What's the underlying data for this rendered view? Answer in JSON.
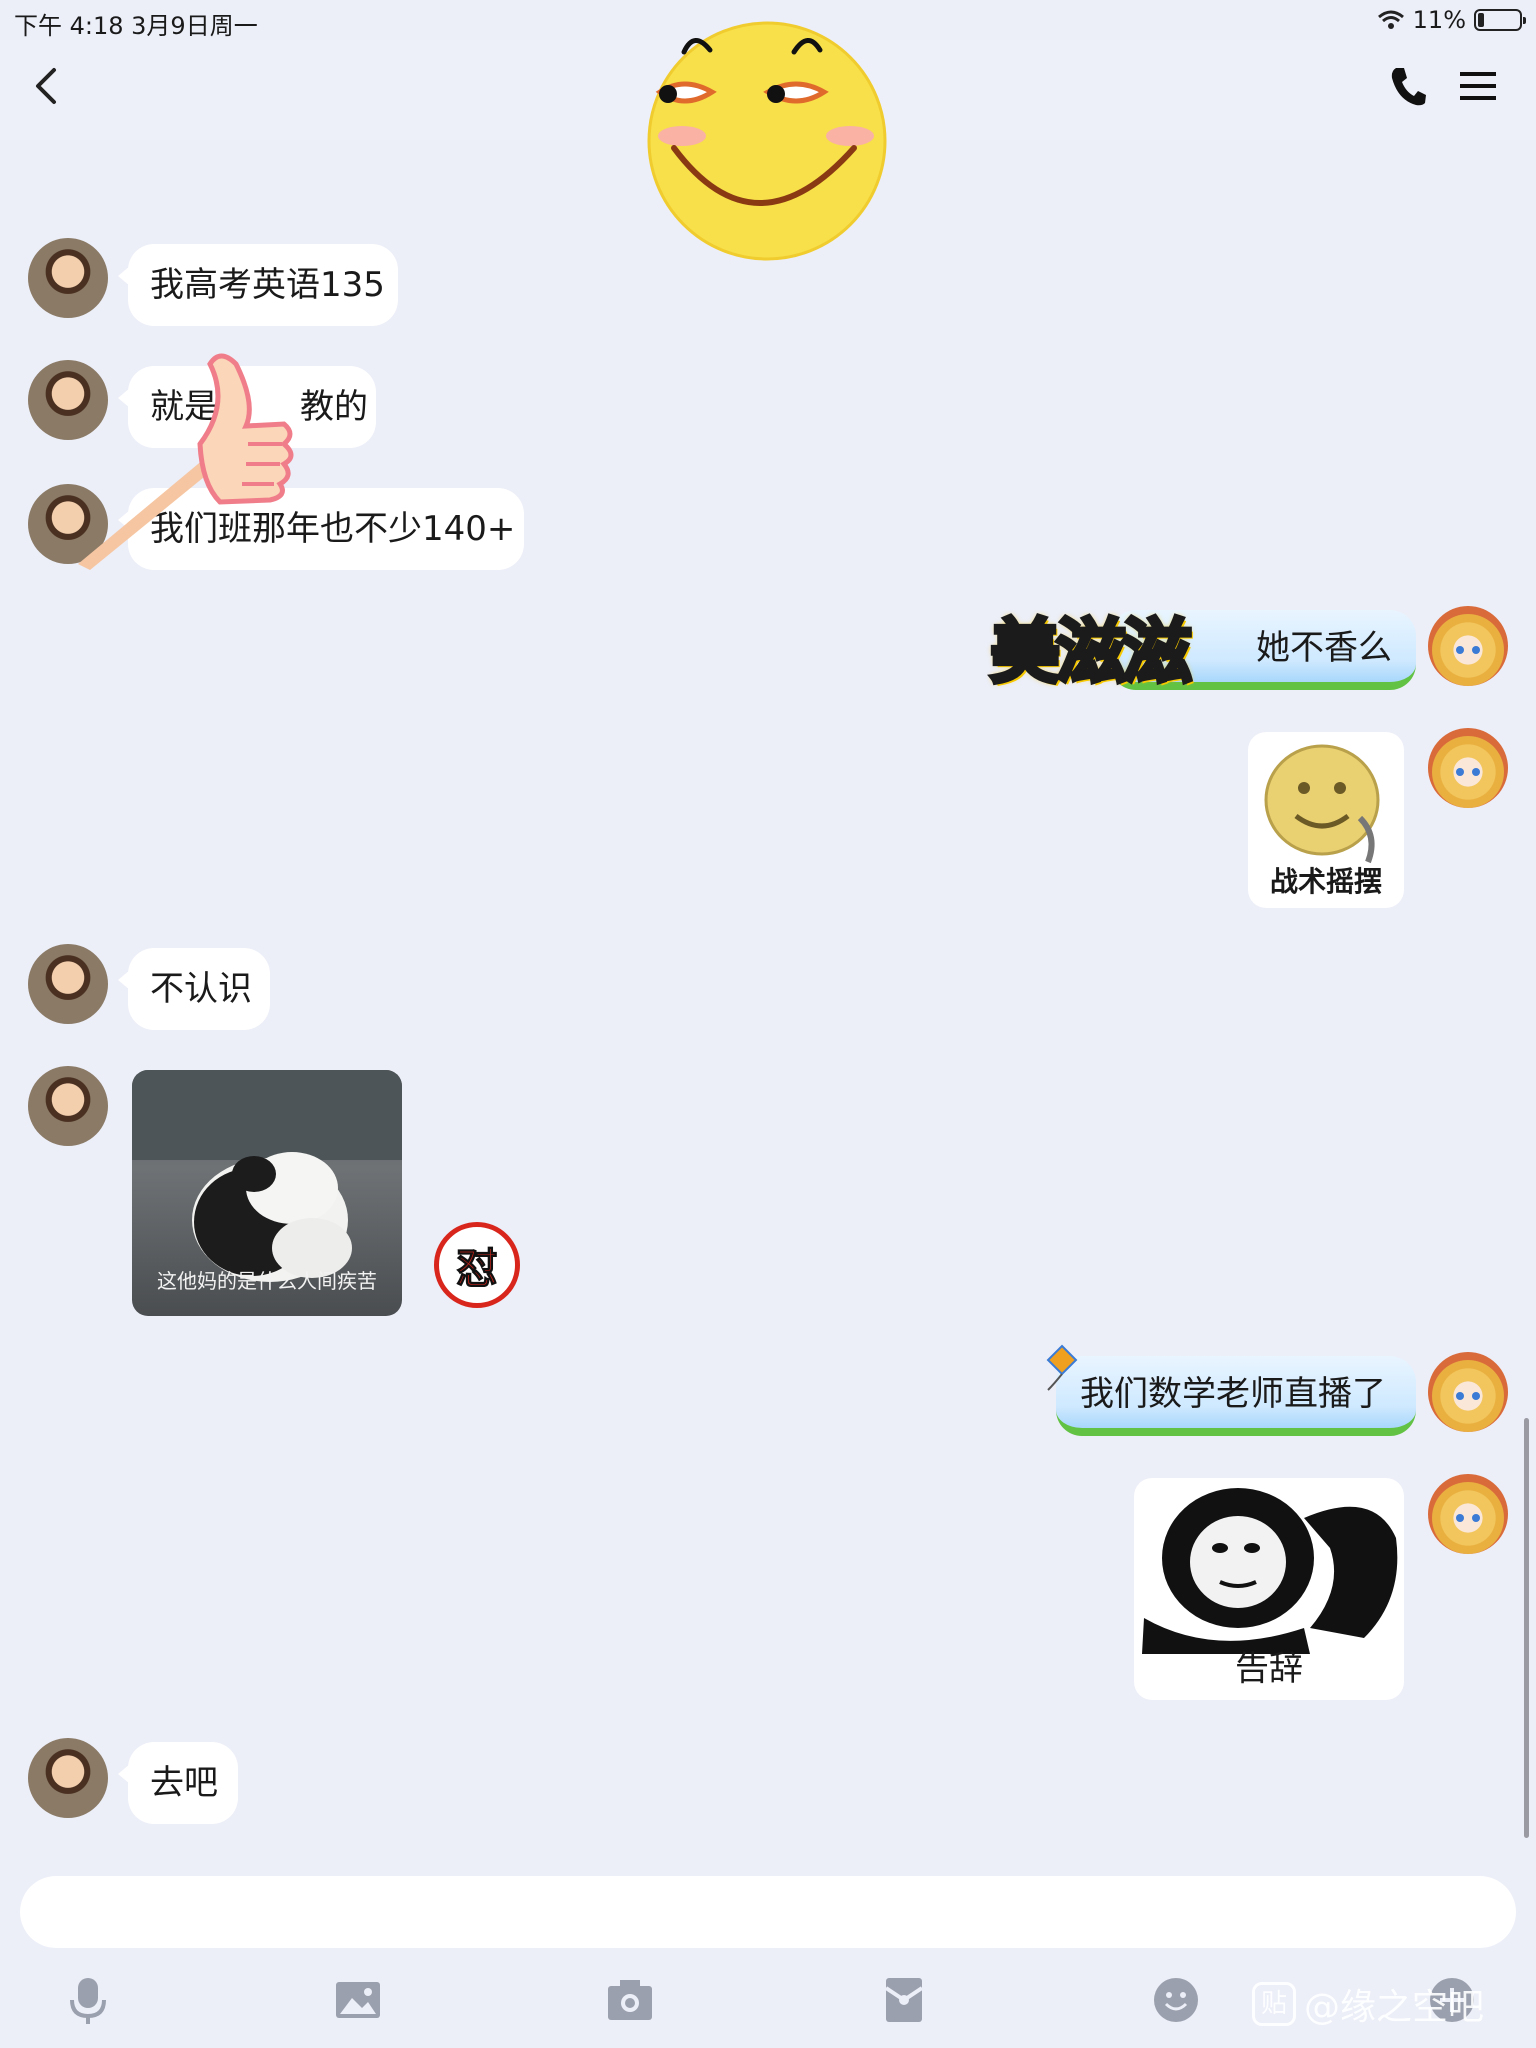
{
  "status_bar": {
    "time_date": "下午 4:18   3月9日周一",
    "battery": "11%"
  },
  "messages": {
    "m1": "我高考英语135",
    "m2a": "就是",
    "m2b": "教的",
    "m3": "我们班那年也不少140+",
    "m4": "她不香么",
    "m4_sticker_text": "美滋滋",
    "m5_caption": "战术摇摆",
    "m6": "不认识",
    "m7_caption": "这他妈的是什么人间疾苦",
    "m7_badge": "怼",
    "m8": "我们数学老师直播了",
    "m9_caption": "告辞",
    "m10": "去吧"
  },
  "input": {
    "placeholder": ""
  },
  "watermark": {
    "logo": "贴",
    "text": "@缘之空吧"
  },
  "icons": [
    "back-icon",
    "phone-icon",
    "menu-icon",
    "mic-icon",
    "image-icon",
    "camera-icon",
    "red-packet-icon",
    "emoji-icon",
    "add-icon"
  ]
}
